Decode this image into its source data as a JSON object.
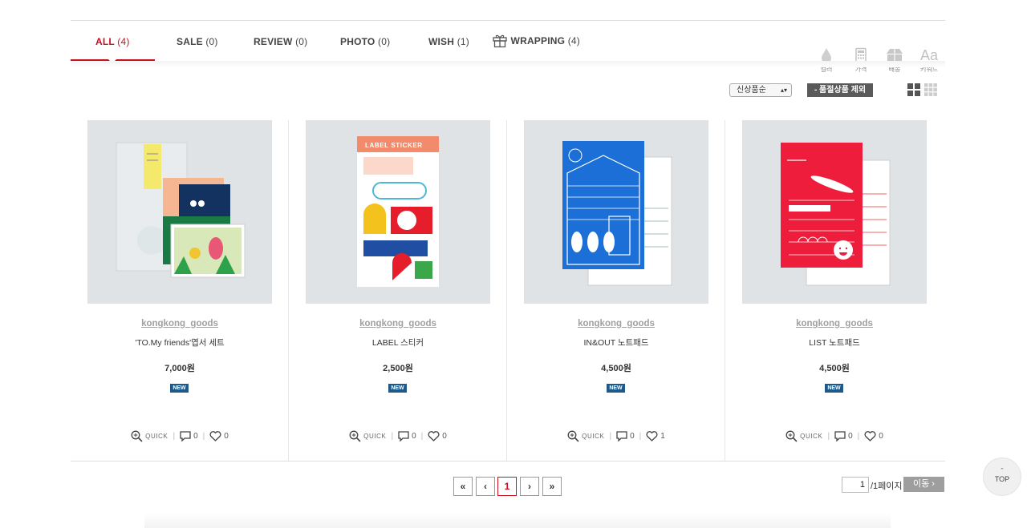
{
  "tabs": [
    {
      "label": "ALL",
      "count": "(4)"
    },
    {
      "label": "SALE",
      "count": "(0)"
    },
    {
      "label": "REVIEW",
      "count": "(0)"
    },
    {
      "label": "PHOTO",
      "count": "(0)"
    },
    {
      "label": "WISH",
      "count": "(1)"
    },
    {
      "label": "WRAPPING",
      "count": "(4)"
    }
  ],
  "active_tab": "ALL",
  "filters": [
    {
      "label": "컬러",
      "icon": "drop-icon"
    },
    {
      "label": "가격",
      "icon": "calculator-icon"
    },
    {
      "label": "배송",
      "icon": "box-icon"
    },
    {
      "label": "키워드",
      "icon": "text-aa-icon"
    }
  ],
  "filter_text_icon_glyph": "Aa",
  "sort": {
    "selected": "신상품순",
    "exclude_label": "- 품절상품 제외"
  },
  "products": [
    {
      "brand": "kongkong_goods",
      "name": "'TO.My friends'엽서 세트",
      "price": "7,000원",
      "badge": "NEW",
      "quick": "QUICK",
      "comments": "0",
      "likes": "0"
    },
    {
      "brand": "kongkong_goods",
      "name": "LABEL 스티커",
      "price": "2,500원",
      "badge": "NEW",
      "quick": "QUICK",
      "comments": "0",
      "likes": "0"
    },
    {
      "brand": "kongkong_goods",
      "name": "IN&OUT 노트패드",
      "price": "4,500원",
      "badge": "NEW",
      "quick": "QUICK",
      "comments": "0",
      "likes": "1"
    },
    {
      "brand": "kongkong_goods",
      "name": "LIST 노트패드",
      "price": "4,500원",
      "badge": "NEW",
      "quick": "QUICK",
      "comments": "0",
      "likes": "0"
    }
  ],
  "pagination": {
    "first": "«",
    "prev": "‹",
    "current": "1",
    "next": "›",
    "last": "»",
    "page_value": "1",
    "total_label": "/1페이지",
    "go_label": "이동 ›"
  },
  "top_button": {
    "caret": "ˆ",
    "label": "TOP"
  },
  "colors": {
    "accent": "#c8101e",
    "badge": "#1c5a8e",
    "thumb_bg": "#dfe3e6"
  }
}
